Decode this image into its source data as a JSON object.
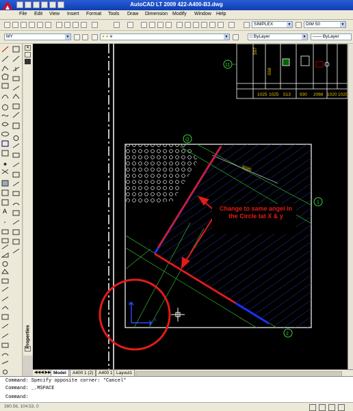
{
  "window": {
    "title": "AutoCAD LT 2009  422-A400-B3.dwg"
  },
  "menu": [
    "File",
    "Edit",
    "View",
    "Insert",
    "Format",
    "Tools",
    "Draw",
    "Dimension",
    "Modify",
    "Window",
    "Help"
  ],
  "toolbar": {
    "workspace": "MY",
    "text_style": "SIMPLEX",
    "dim_style": "DIM 50",
    "color": "ByLayer",
    "linetype": "ByLayer"
  },
  "properties_label": "Properties",
  "drawing": {
    "dimensions_top": [
      "1025",
      "1025",
      "513",
      "930",
      "2066",
      "1020",
      "1020"
    ],
    "dim_vertical": [
      "507",
      "558"
    ],
    "grid_labels": [
      "11",
      "Q",
      "1",
      "2"
    ],
    "diagonal_dim": "4690",
    "annotation": "Change to same angel in the Circle tat X & y",
    "ucs_y": "Y",
    "ucs_x": "X"
  },
  "tabs": [
    "Model",
    "A400 1 (2)",
    "A400 1",
    "Layout1"
  ],
  "command_lines": [
    "Command: Specify opposite corner: *Cancel*",
    "Command: _.MSPACE",
    "Command:"
  ],
  "status": {
    "coords": "380.56, 104.53, 0"
  },
  "colors": {
    "annotation_red": "#e31b1b",
    "highlight_blue": "#1a33ff",
    "canvas_bg": "#000000",
    "hatch_blue": "#1e2a9e"
  }
}
